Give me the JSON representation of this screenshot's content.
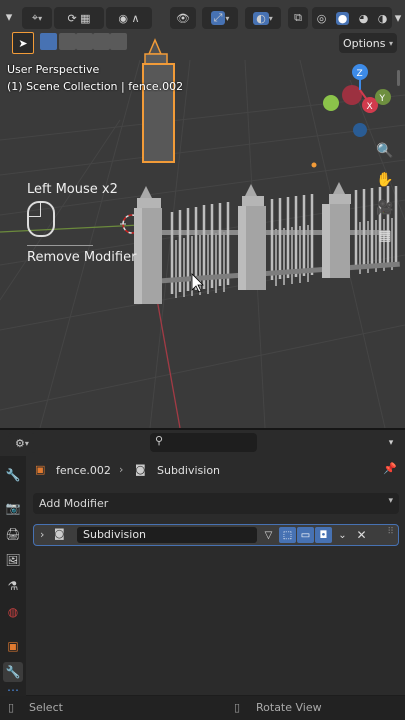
{
  "viewport": {
    "perspective_label": "User Perspective",
    "collection_label": "(1) Scene Collection | fence.002",
    "options_label": "Options",
    "gizmo_axes": {
      "x": "X",
      "y": "Y",
      "z": "Z"
    },
    "hint_action": "Left Mouse x2",
    "hint_result": "Remove Modifier"
  },
  "properties": {
    "breadcrumb_object": "fence.002",
    "breadcrumb_modifier": "Subdivision",
    "add_modifier_label": "Add Modifier",
    "modifier_name": "Subdivision"
  },
  "statusbar": {
    "left_label": "Select",
    "right_label": "Rotate View"
  },
  "colors": {
    "accent": "#4772b3",
    "selected_outline": "#f29b38",
    "axis_x": "#d13b4d",
    "axis_y": "#8bc34a",
    "axis_z": "#3d8be8"
  }
}
